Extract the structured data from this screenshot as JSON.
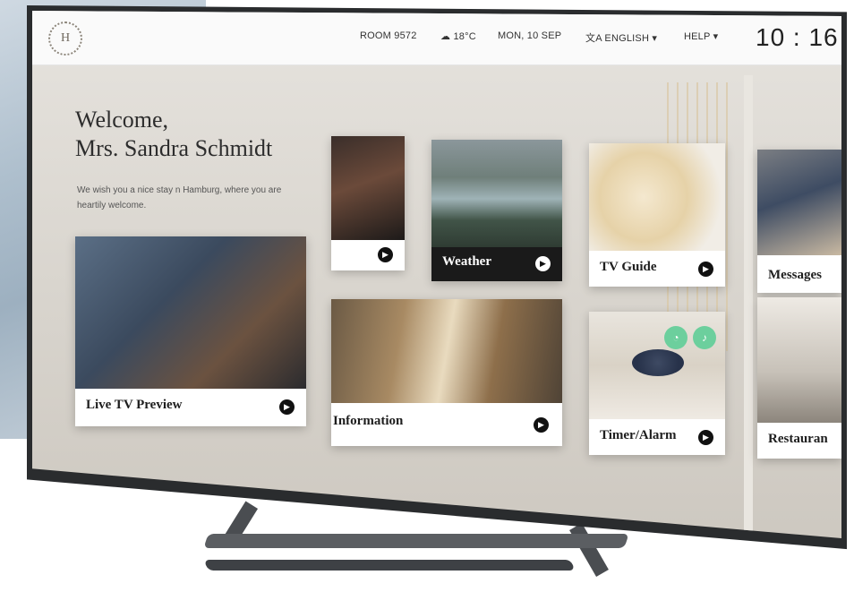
{
  "topbar": {
    "logo_letter": "H",
    "room": "ROOM 9572",
    "weather": "18°C",
    "date": "MON, 10 SEP",
    "language": "ENGLISH ▾",
    "help": "HELP ▾",
    "clock": "10 : 16"
  },
  "welcome": {
    "line1": "Welcome,",
    "line2": "Mrs. Sandra Schmidt",
    "subtitle": "We wish you a nice stay n Hamburg, where you are heartily welcome."
  },
  "tiles": {
    "live_tv": "Live TV Preview",
    "weather": "Weather",
    "tv_guide": "TV Guide",
    "messages": "Messages",
    "information": "Information",
    "timer": "Timer/Alarm",
    "restaurant": "Restauran"
  },
  "colors": {
    "accent_green": "#6ccf9d",
    "action_dark": "#111111"
  }
}
